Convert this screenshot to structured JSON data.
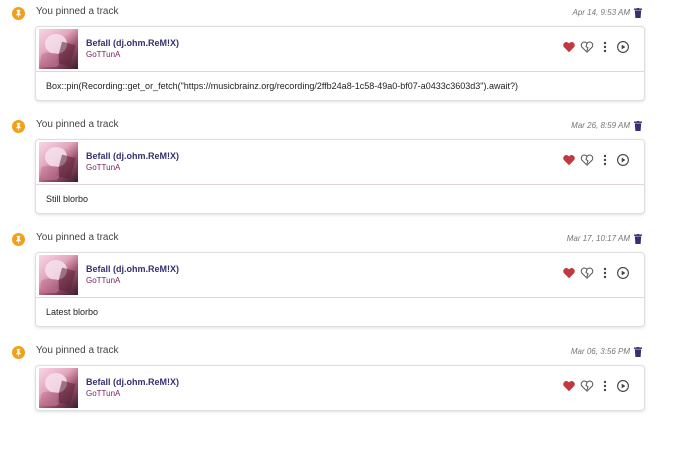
{
  "events": [
    {
      "action_text": "You pinned a track",
      "time": "Apr 14, 9:53 AM",
      "track": "Befall (dj.ohm.ReM!X)",
      "artist": "GoTTunA",
      "blurb": "Box::pin(Recording::get_or_fetch(\"https://musicbrainz.org/recording/2ffb24a8-1c58-49a0-bf07-a0433c3603d3\").await?)"
    },
    {
      "action_text": "You pinned a track",
      "time": "Mar 26, 8:59 AM",
      "track": "Befall (dj.ohm.ReM!X)",
      "artist": "GoTTunA",
      "blurb": "Still blorbo"
    },
    {
      "action_text": "You pinned a track",
      "time": "Mar 17, 10:17 AM",
      "track": "Befall (dj.ohm.ReM!X)",
      "artist": "GoTTunA",
      "blurb": "Latest blorbo"
    },
    {
      "action_text": "You pinned a track",
      "time": "Mar 06, 3:56 PM",
      "track": "Befall (dj.ohm.ReM!X)",
      "artist": "GoTTunA",
      "blurb": ""
    }
  ],
  "icons": {
    "pin": "pin-icon",
    "delete": "trash-icon",
    "love": "heart-icon",
    "hate": "broken-heart-icon",
    "more": "more-options-icon",
    "play": "play-icon"
  },
  "colors": {
    "pin_badge": "#f0a11c",
    "love": "#c0393e",
    "title": "#353070",
    "artist": "#7a2063",
    "trash": "#353070"
  }
}
